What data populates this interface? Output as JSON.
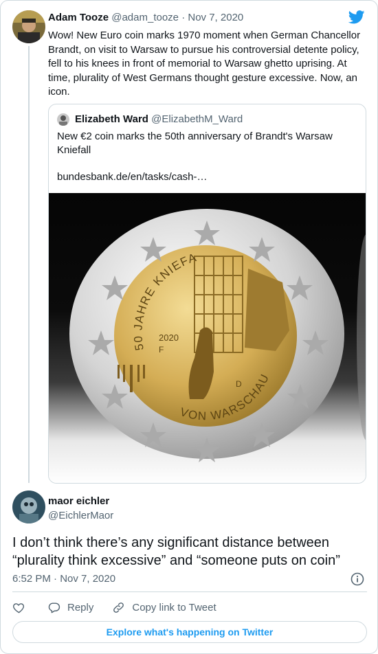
{
  "parent_tweet": {
    "display_name": "Adam Tooze",
    "handle": "@adam_tooze",
    "separator": " · ",
    "date": "Nov 7, 2020",
    "text": "Wow! New Euro coin marks 1970 moment when German Chancellor Brandt, on visit to Warsaw to pursue his controversial detente policy, fell to his knees in front of memorial to Warsaw ghetto uprising. At time, plurality of West Germans thought gesture excessive. Now, an icon."
  },
  "quoted_tweet": {
    "display_name": "Elizabeth Ward",
    "handle": "@ElizabethM_Ward",
    "text": "New €2 coin marks the 50th anniversary of Brandt's Warsaw Kniefall",
    "link": "bundesbank.de/en/tasks/cash-…",
    "coin": {
      "arc_text_top": "50 JAHRE KNIEFALL",
      "arc_text_bottom": "VON WARSCHAU",
      "year": "2020",
      "mint_mark_left": "F",
      "mint_mark_right": "D"
    }
  },
  "reply_tweet": {
    "display_name": "maor eichler",
    "handle": "@EichlerMaor",
    "text": "I don’t think there’s any significant distance between “plurality think excessive” and “someone puts on coin”",
    "timestamp": "6:52 PM · Nov 7, 2020"
  },
  "actions": {
    "reply_label": "Reply",
    "copy_label": "Copy link to Tweet"
  },
  "footer": {
    "explore_label": "Explore what's happening on Twitter"
  },
  "colors": {
    "twitter_blue": "#1d9bf0",
    "secondary_text": "#536471",
    "border": "#cfd9de",
    "coin_gold": "#c9a445",
    "coin_silver": "#d7d7d7"
  },
  "icons": [
    "twitter-bird-icon",
    "info-icon",
    "heart-icon",
    "reply-bubble-icon",
    "link-icon"
  ]
}
